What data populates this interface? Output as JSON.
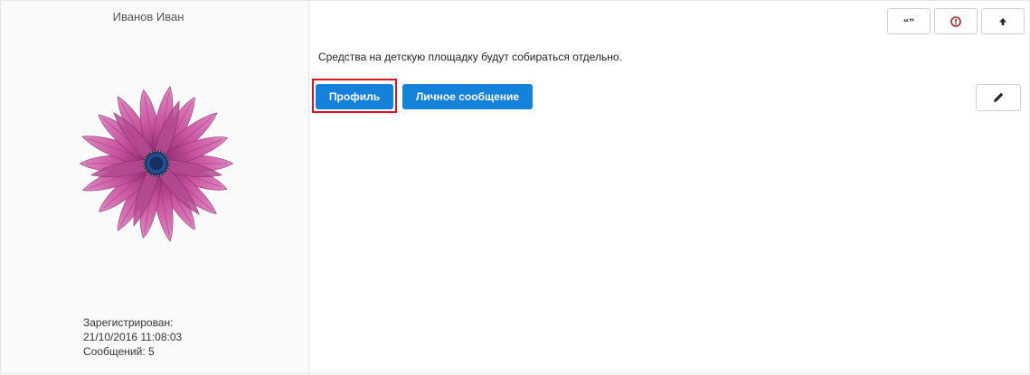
{
  "author": {
    "name": "Иванов Иван",
    "avatar_icon": "flower-avatar",
    "registered_label": "Зарегистрирован:",
    "registered_date": "21/10/2016 11:08:03",
    "messages": "Сообщений: 5"
  },
  "post": {
    "text": "Средства на детскую площадку будут собираться отдельно."
  },
  "actions": {
    "quote_icon": "quote-icon",
    "report_icon": "report-icon",
    "up_icon": "arrow-up-icon",
    "edit_icon": "pencil-icon"
  },
  "buttons": {
    "profile": "Профиль",
    "message": "Личное сообщение"
  },
  "colors": {
    "primary": "#1481db",
    "highlight": "#e0141e",
    "report": "#b3262d"
  }
}
